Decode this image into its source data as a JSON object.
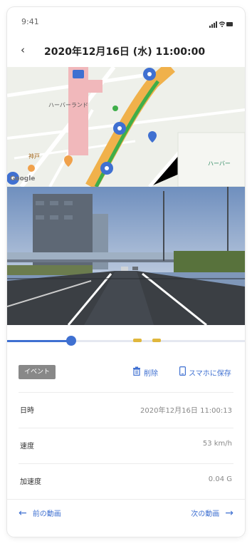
{
  "status_bar": {
    "time": "9:41"
  },
  "header": {
    "back_icon": "chevron-left-icon",
    "title": "2020年12月16日 (水) 11:00:00"
  },
  "map": {
    "provider_label": "Google",
    "labels": [
      "ハーバーランド",
      "神戸",
      "ハーバー"
    ],
    "route_color": "#3fae49"
  },
  "video": {},
  "playback": {
    "progress": 0.27,
    "marker_positions": [
      0.53,
      0.61
    ]
  },
  "actions": {
    "event_badge": "イベント",
    "delete_label": "削除",
    "save_label": "スマホに保存"
  },
  "details": [
    {
      "label": "日時",
      "value": "2020年12月16日 11:00:13"
    },
    {
      "label": "速度",
      "value": "53 km/h"
    },
    {
      "label": "加速度",
      "value": "0.04 G"
    }
  ],
  "footer": {
    "prev_label": "前の動画",
    "next_label": "次の動画"
  },
  "colors": {
    "accent": "#3f70d1",
    "marker": "#e0b73c",
    "badge": "#888888"
  }
}
